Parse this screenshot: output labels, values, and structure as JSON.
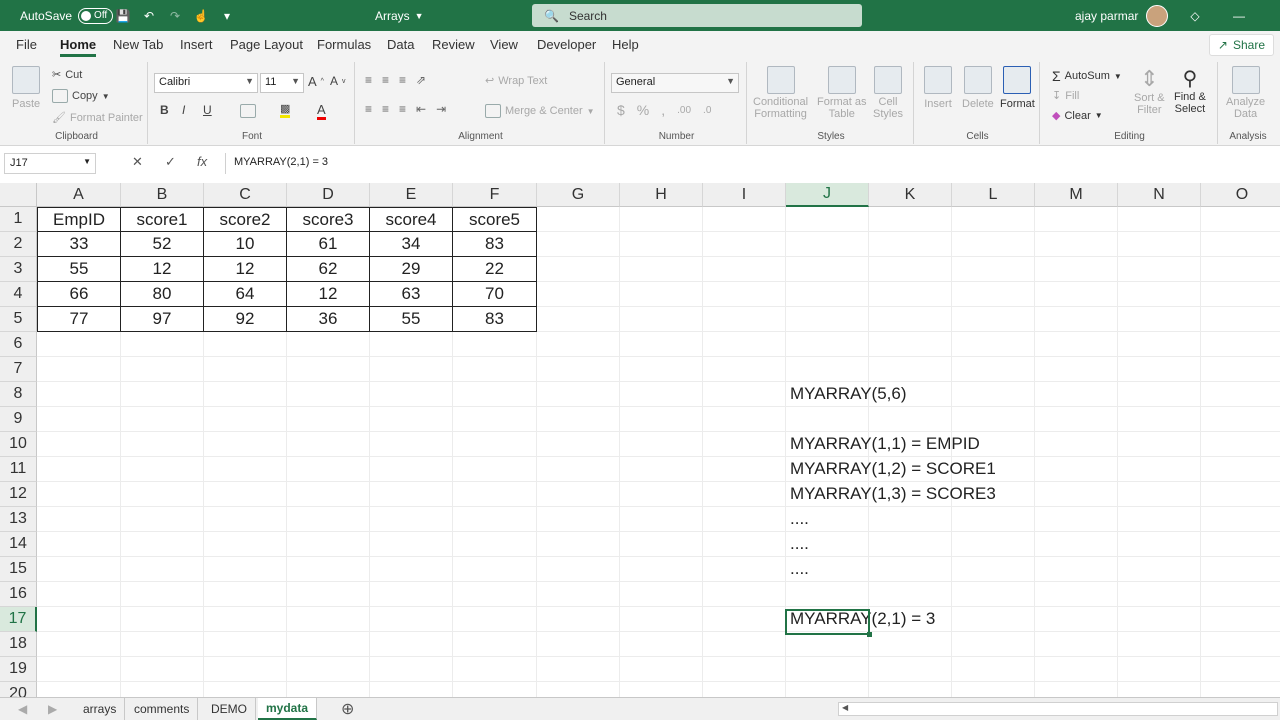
{
  "titlebar": {
    "autosave_label": "AutoSave",
    "autosave_state": "Off",
    "doc_title": "Arrays",
    "search_placeholder": "Search",
    "user_name": "ajay parmar"
  },
  "ribbon_tabs": [
    "File",
    "Home",
    "New Tab",
    "Insert",
    "Page Layout",
    "Formulas",
    "Data",
    "Review",
    "View",
    "Developer",
    "Help"
  ],
  "active_tab": "Home",
  "share_label": "Share",
  "clipboard": {
    "paste": "Paste",
    "cut": "Cut",
    "copy": "Copy",
    "format_painter": "Format Painter",
    "label": "Clipboard"
  },
  "font": {
    "name": "Calibri",
    "size": "11",
    "label": "Font"
  },
  "alignment": {
    "wrap_text": "Wrap Text",
    "merge_center": "Merge & Center",
    "label": "Alignment"
  },
  "number": {
    "format": "General",
    "label": "Number"
  },
  "styles": {
    "conditional": "Conditional",
    "conditional2": "Formatting",
    "format_as": "Format as",
    "format_as2": "Table",
    "cell": "Cell",
    "cell2": "Styles",
    "label": "Styles"
  },
  "cells": {
    "insert": "Insert",
    "delete": "Delete",
    "format": "Format",
    "label": "Cells"
  },
  "editing": {
    "autosum": "AutoSum",
    "fill": "Fill",
    "clear": "Clear",
    "sort": "Sort &",
    "sort2": "Filter",
    "find": "Find &",
    "find2": "Select",
    "label": "Editing"
  },
  "analysis": {
    "analyze": "Analyze",
    "analyze2": "Data",
    "label": "Analysis"
  },
  "formula_bar": {
    "name_box": "J17",
    "formula": "MYARRAY(2,1) = 3"
  },
  "columns": [
    "A",
    "B",
    "C",
    "D",
    "E",
    "F",
    "G",
    "H",
    "I",
    "J",
    "K",
    "L",
    "M",
    "N",
    "O"
  ],
  "rows": [
    "1",
    "2",
    "3",
    "4",
    "5",
    "6",
    "7",
    "8",
    "9",
    "10",
    "11",
    "12",
    "13",
    "14",
    "15",
    "16",
    "17",
    "18",
    "19",
    "20"
  ],
  "table": {
    "headers": [
      "EmpID",
      "score1",
      "score2",
      "score3",
      "score4",
      "score5"
    ],
    "data": [
      [
        "33",
        "52",
        "10",
        "61",
        "34",
        "83"
      ],
      [
        "55",
        "12",
        "12",
        "62",
        "29",
        "22"
      ],
      [
        "66",
        "80",
        "64",
        "12",
        "63",
        "70"
      ],
      [
        "77",
        "97",
        "92",
        "36",
        "55",
        "83"
      ]
    ]
  },
  "notes": [
    {
      "row": 8,
      "text": "MYARRAY(5,6)"
    },
    {
      "row": 10,
      "text": "MYARRAY(1,1) = EMPID"
    },
    {
      "row": 11,
      "text": "MYARRAY(1,2) = SCORE1"
    },
    {
      "row": 12,
      "text": "MYARRAY(1,3) = SCORE3"
    },
    {
      "row": 13,
      "text": "...."
    },
    {
      "row": 14,
      "text": "...."
    },
    {
      "row": 15,
      "text": "...."
    },
    {
      "row": 17,
      "text": "MYARRAY(2,1) = 3"
    }
  ],
  "sheets": [
    "arrays",
    "comments",
    "DEMO",
    "mydata"
  ],
  "active_sheet": "mydata",
  "colors": {
    "brand": "#217346"
  }
}
